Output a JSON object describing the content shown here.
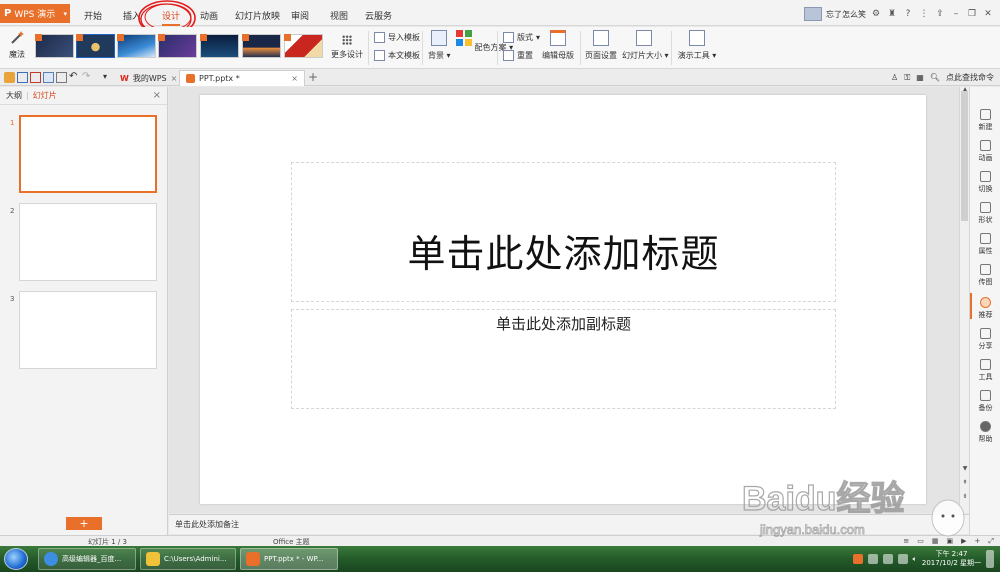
{
  "app": {
    "name": "WPS 演示",
    "logo": "P"
  },
  "menu": {
    "tabs": [
      "开始",
      "插入",
      "设计",
      "动画",
      "幻灯片放映",
      "审阅",
      "视图",
      "云服务"
    ],
    "active": "设计"
  },
  "user": {
    "name": "忘了怎么笑"
  },
  "ribbon": {
    "magic_label": "魔法",
    "more_design": "更多设计",
    "import_template": "导入模板",
    "this_template": "本文模板",
    "background": "背景",
    "color_scheme": "配色方案",
    "layout": "版式",
    "reset": "重置",
    "edit_master": "编辑母版",
    "page_setup": "页面设置",
    "slide_size": "幻灯片大小",
    "presentation_tools": "演示工具"
  },
  "tabs": {
    "mywps": "我的WPS",
    "document": "PPT.pptx *",
    "search_commands": "点此查找命令"
  },
  "left_panel": {
    "outline": "大纲",
    "slides": "幻灯片",
    "slide_numbers": [
      "1",
      "2",
      "3"
    ],
    "add_button": "+"
  },
  "slide": {
    "title_placeholder": "单击此处添加标题",
    "subtitle_placeholder": "单击此处添加副标题"
  },
  "notes": {
    "placeholder": "单击此处添加备注"
  },
  "right_bar": [
    "新建",
    "动画",
    "切换",
    "形状",
    "属性",
    "传图",
    "推荐",
    "分享",
    "工具",
    "备份",
    "帮助"
  ],
  "status": {
    "slide_counter": "幻灯片 1 / 3",
    "theme": "Office 主题"
  },
  "taskbar": {
    "items": [
      "高级编辑器_百度...",
      "C:\\Users\\Admini...",
      "PPT.pptx * - WP..."
    ],
    "time": "下午 2:47",
    "date": "2017/10/2 星期一"
  },
  "watermark": {
    "text": "Baidu经验",
    "url": "jingyan.baidu.com"
  },
  "colors": {
    "accent": "#e8702a",
    "annotation": "#e21b1b"
  }
}
